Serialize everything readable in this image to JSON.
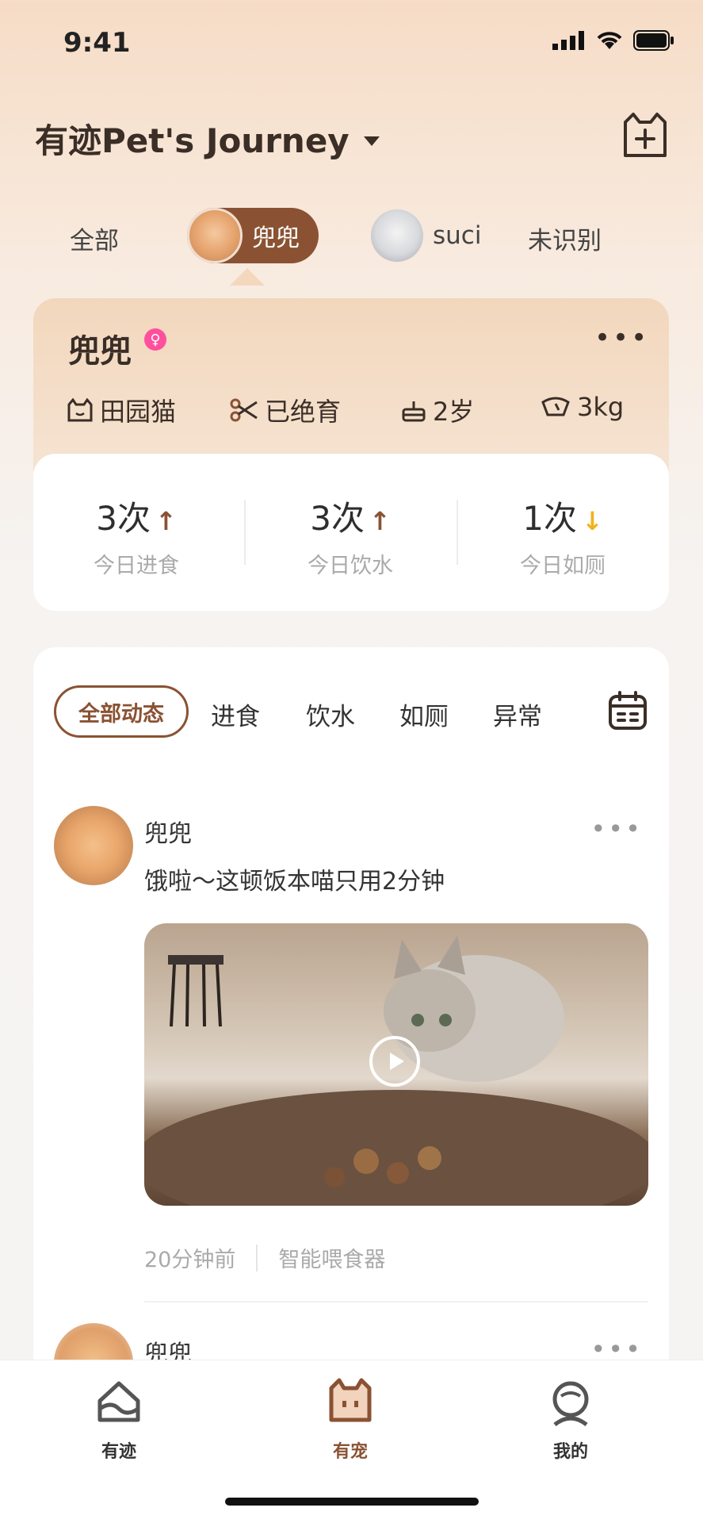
{
  "status_bar": {
    "time": "9:41"
  },
  "header": {
    "title": "有迹Pet's Journey"
  },
  "pet_tabs": {
    "all": "全部",
    "selected": "兜兜",
    "second": "suci",
    "unknown": "未识别"
  },
  "pet_card": {
    "name": "兜兜",
    "gender_symbol": "♀",
    "breed": "田园猫",
    "neutered": "已绝育",
    "age": "2岁",
    "weight": "3kg"
  },
  "stats": [
    {
      "value": "3次",
      "label": "今日进食",
      "arrow": "↑",
      "arrow_color": "#8a5233"
    },
    {
      "value": "3次",
      "label": "今日饮水",
      "arrow": "↑",
      "arrow_color": "#8a5233"
    },
    {
      "value": "1次",
      "label": "今日如厕",
      "arrow": "↓",
      "arrow_color": "#f2b21c"
    }
  ],
  "feed_filters": {
    "all": "全部动态",
    "eat": "进食",
    "drink": "饮水",
    "toilet": "如厕",
    "abnormal": "异常"
  },
  "posts": [
    {
      "author": "兜兜",
      "text": "饿啦～这顿饭本喵只用2分钟",
      "time": "20分钟前",
      "source": "智能喂食器"
    },
    {
      "author": "兜兜"
    }
  ],
  "more_glyph": "•••",
  "tabbar": {
    "tab1": "有迹",
    "tab2": "有宠",
    "tab3": "我的"
  },
  "colors": {
    "accent": "#8a5233",
    "gender": "#ff4f9d",
    "down_arrow": "#f2b21c"
  }
}
